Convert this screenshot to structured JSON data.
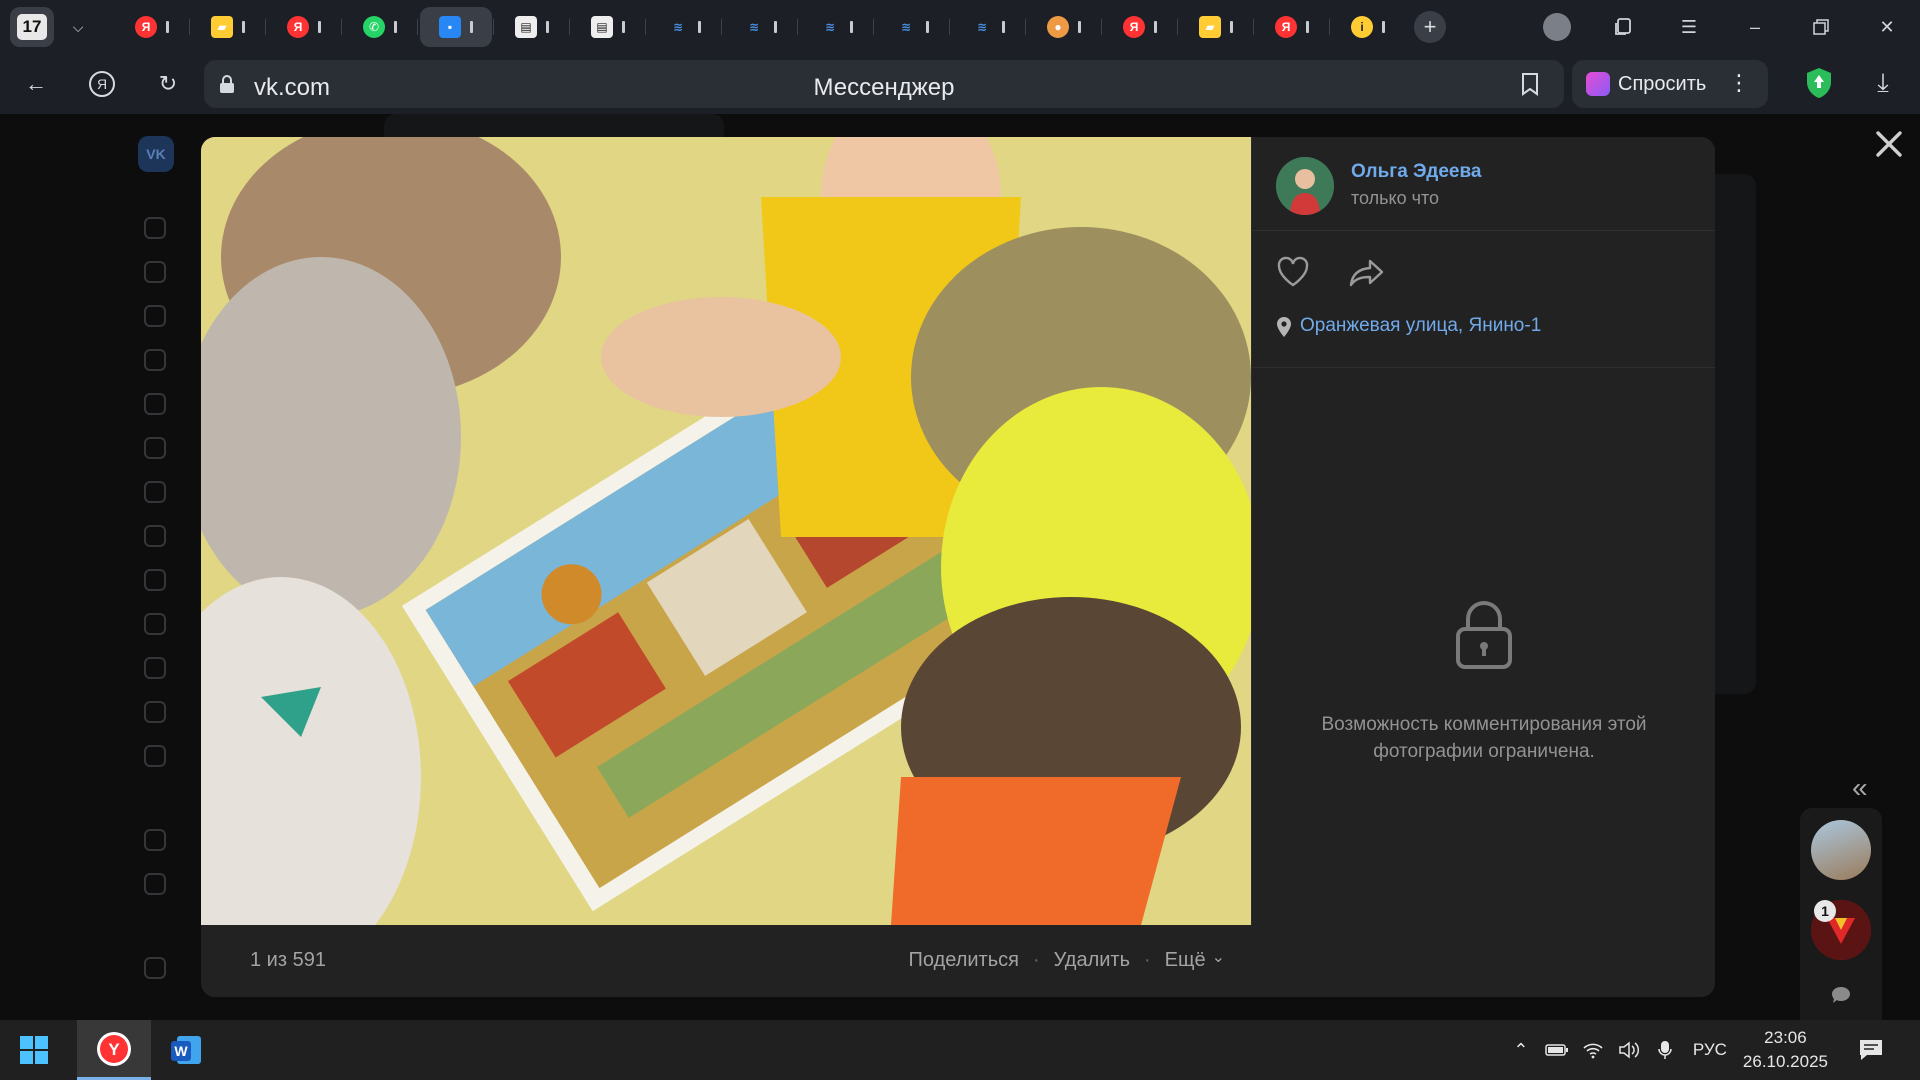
{
  "browser": {
    "tab_count": "17",
    "tabs": [
      {
        "icon": "yandex-icon",
        "color": "#f33"
      },
      {
        "icon": "yandex-images-icon",
        "color": "#fc3"
      },
      {
        "icon": "yandex-icon",
        "color": "#f33"
      },
      {
        "icon": "whatsapp-icon",
        "color": "#25d366"
      },
      {
        "icon": "vk-messenger-icon",
        "color": "#2787f5",
        "active": true
      },
      {
        "icon": "document-icon",
        "color": "#eee"
      },
      {
        "icon": "document-icon",
        "color": "#eee"
      },
      {
        "icon": "gosuslugi-icon",
        "color": "#4a90e2"
      },
      {
        "icon": "gosuslugi-icon",
        "color": "#4a90e2"
      },
      {
        "icon": "gosuslugi-icon",
        "color": "#4a90e2"
      },
      {
        "icon": "gosuslugi-icon",
        "color": "#4a90e2"
      },
      {
        "icon": "gosuslugi-icon",
        "color": "#4a90e2"
      },
      {
        "icon": "chrome-like-icon",
        "color": "#e94"
      },
      {
        "icon": "yandex-icon",
        "color": "#f33"
      },
      {
        "icon": "yandex-images-icon",
        "color": "#fc3"
      },
      {
        "icon": "yandex-icon",
        "color": "#f33"
      },
      {
        "icon": "info-icon",
        "color": "#fc3"
      }
    ],
    "url_domain": "vk.com",
    "page_title": "Мессенджер",
    "ask_label": "Спросить"
  },
  "viewer": {
    "author_name": "Ольга Эдеева",
    "posted_time": "только что",
    "location": "Оранжевая улица, Янино-1",
    "comments_locked": "Возможность комментирования этой фотографии ограничена.",
    "counter": "1 из 591",
    "actions": {
      "share": "Поделиться",
      "delete": "Удалить",
      "more": "Ещё",
      "separator": "·"
    }
  },
  "chats": {
    "unread_badge": "1"
  },
  "taskbar": {
    "lang": "РУС",
    "time": "23:06",
    "date": "26.10.2025"
  },
  "colors": {
    "link": "#71aaeb",
    "viewer_bg": "#222222",
    "muted_text": "#939393"
  }
}
